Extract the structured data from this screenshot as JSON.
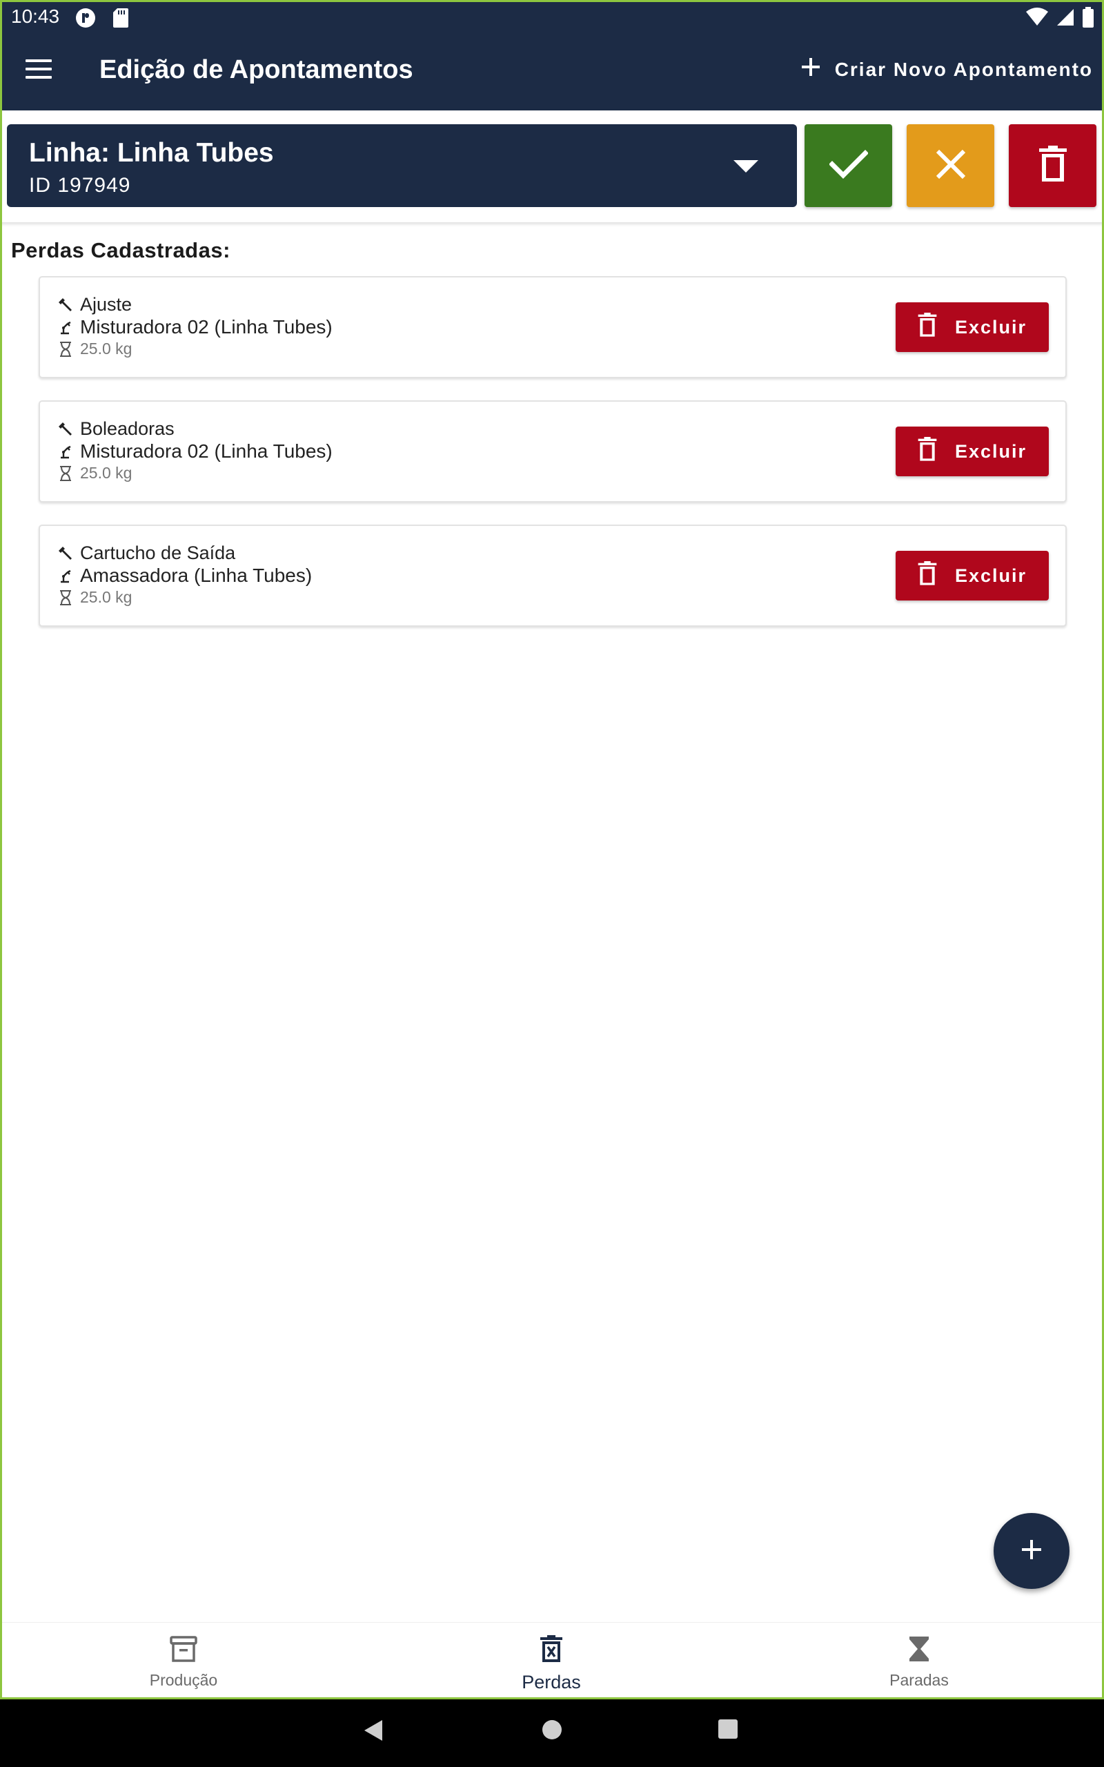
{
  "status_bar": {
    "time": "10:43",
    "icons": [
      "p-app-icon",
      "sd-card-icon",
      "wifi-icon",
      "signal-icon",
      "battery-icon"
    ]
  },
  "app_bar": {
    "title": "Edição de Apontamentos",
    "create_label": "Criar Novo Apontamento"
  },
  "line_selector": {
    "line_label": "Linha: Linha Tubes",
    "id_label": "ID 197949"
  },
  "actions": {
    "confirm": "check-icon",
    "cancel": "close-icon",
    "delete": "trash-icon"
  },
  "losses": {
    "title": "Perdas Cadastradas:",
    "items": [
      {
        "reason": "Ajuste",
        "machine": "Misturadora 02 (Linha Tubes)",
        "quantity": "25.0 kg",
        "delete_label": "Excluir"
      },
      {
        "reason": "Boleadoras",
        "machine": "Misturadora 02 (Linha Tubes)",
        "quantity": "25.0 kg",
        "delete_label": "Excluir"
      },
      {
        "reason": "Cartucho de Saída",
        "machine": "Amassadora (Linha Tubes)",
        "quantity": "25.0 kg",
        "delete_label": "Excluir"
      }
    ]
  },
  "bottom_nav": {
    "items": [
      {
        "label": "Produção",
        "icon": "archive-icon",
        "active": false
      },
      {
        "label": "Perdas",
        "icon": "trash-x-icon",
        "active": true
      },
      {
        "label": "Paradas",
        "icon": "hourglass-icon",
        "active": false
      }
    ]
  },
  "colors": {
    "primary": "#1c2b45",
    "confirm": "#3a7a1f",
    "cancel": "#e39b1b",
    "danger": "#b0071c"
  }
}
